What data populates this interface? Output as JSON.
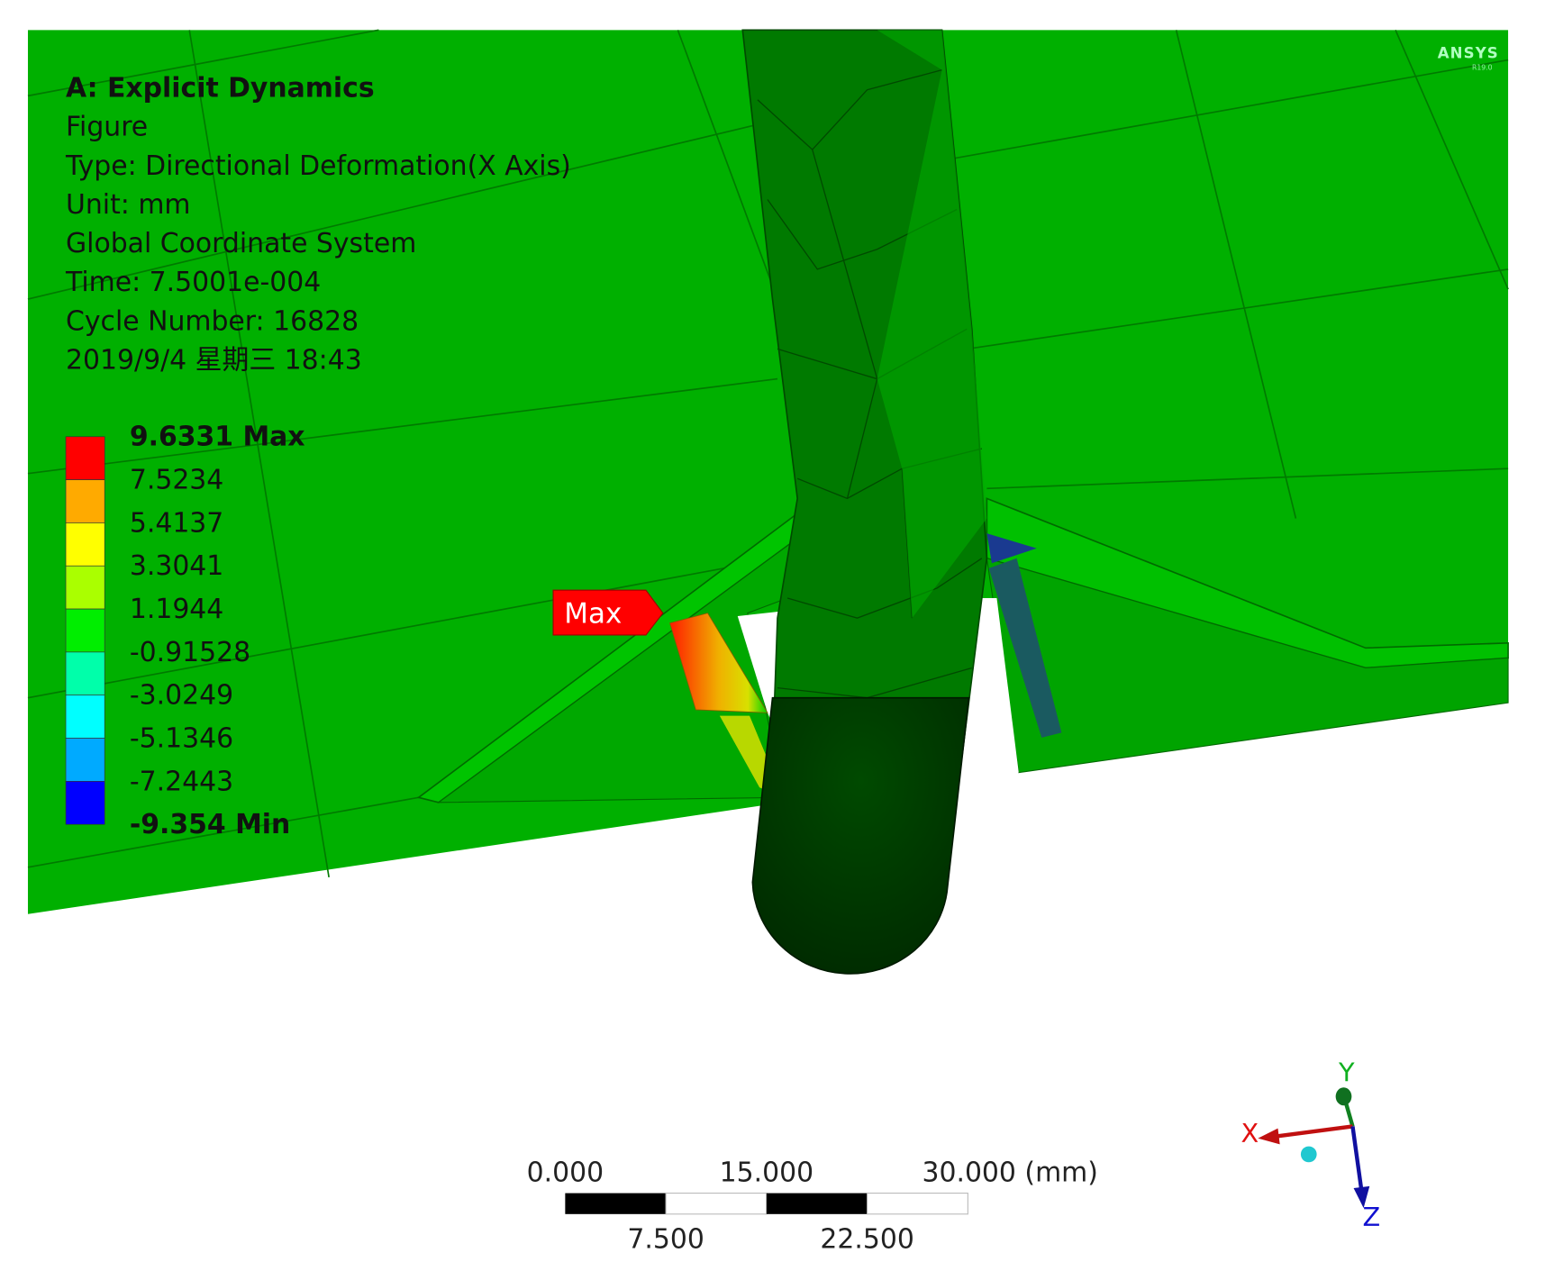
{
  "info": {
    "title": "A: Explicit Dynamics",
    "lines": [
      "Figure",
      "Type: Directional Deformation(X Axis)",
      "Unit: mm",
      "Global Coordinate System",
      "Time: 7.5001e-004",
      "Cycle Number: 16828",
      "2019/9/4 星期三 18:43"
    ]
  },
  "logo": {
    "text": "ANSYS",
    "version": "R19.0"
  },
  "legend": {
    "labels": [
      "9.6331 Max",
      "7.5234",
      "5.4137",
      "3.3041",
      "1.1944",
      "-0.91528",
      "-3.0249",
      "-5.1346",
      "-7.2443",
      "-9.354 Min"
    ],
    "colors": [
      "#ff0000",
      "#ffaa00",
      "#ffff00",
      "#aaff00",
      "#00ee00",
      "#00ffaa",
      "#00ffff",
      "#00aaff",
      "#0000ff"
    ]
  },
  "probe": {
    "max_label": "Max"
  },
  "scale_bar": {
    "top_labels": [
      "0.000",
      "15.000",
      "30.000 (mm)"
    ],
    "bottom_labels": [
      "7.500",
      "22.500"
    ]
  },
  "triad": {
    "x": "X",
    "y": "Y",
    "z": "Z",
    "x_color": "#e01010",
    "y_color": "#10a020",
    "z_color": "#1010d0"
  },
  "colors": {
    "model_green": "#00b000",
    "rod_dark": "#006400"
  }
}
